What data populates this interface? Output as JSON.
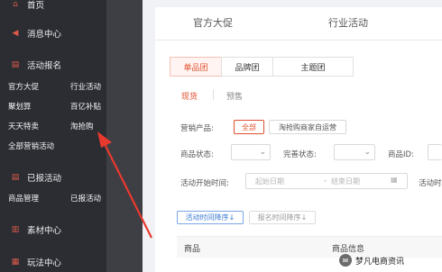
{
  "sidebar": {
    "home_label": "首页",
    "messages_label": "消息中心",
    "activity_signup_label": "活动报名",
    "activity_sub": [
      "官方大促",
      "行业活动",
      "聚划算",
      "百亿补贴",
      "天天特卖",
      "淘抢购",
      "全部营销活动"
    ],
    "joined_label": "已报活动",
    "joined_sub": [
      "商品管理",
      "已报活动"
    ],
    "assets_label": "素材中心",
    "play_label": "玩法中心"
  },
  "top_tabs": [
    "官方大促",
    "行业活动"
  ],
  "segments": [
    "单品团",
    "品牌团",
    "主题团"
  ],
  "sub_tabs": [
    "现货",
    "预售"
  ],
  "filters": {
    "marketing_product_label": "营销产品:",
    "chip_all": "全部",
    "chip_merchant": "淘抢购商家自运营",
    "product_status_label": "商品状态:",
    "completeness_label": "完善状态:",
    "product_id_label": "商品ID:",
    "start_time_label": "活动开始时间:",
    "start_placeholder": "起始日期",
    "dash": "-",
    "end_placeholder": "结束日期",
    "activity_cut_label": "活动时"
  },
  "sort": {
    "by_time": "活动时间降序↓",
    "by_signup": "报名时间降序↓"
  },
  "table": {
    "col_product": "商品",
    "col_info": "商品信息"
  },
  "watermark": {
    "text": "梦凡电商资讯"
  },
  "colors": {
    "accent": "#e0502f",
    "sidebar_bg": "#2b2d33",
    "arrow": "#e8392f"
  }
}
